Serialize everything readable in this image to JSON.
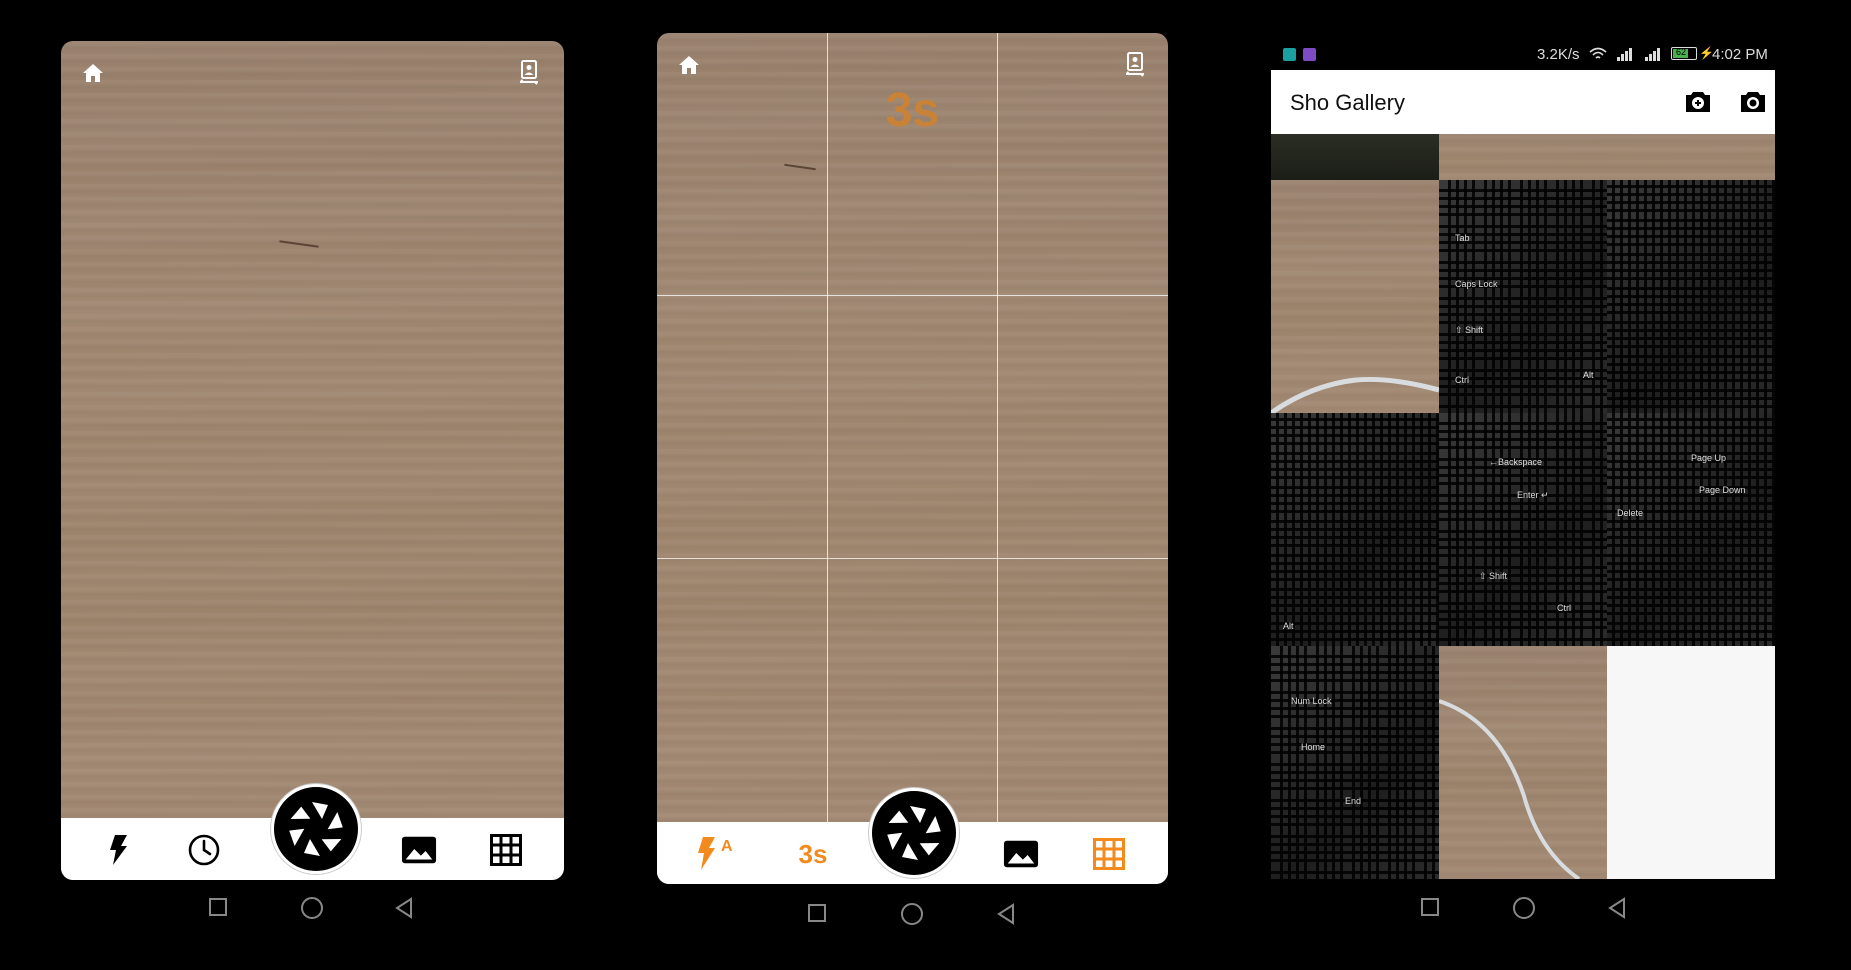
{
  "screen2": {
    "timer_overlay": "3s",
    "timer_button": "3s"
  },
  "screen3": {
    "status": {
      "speed": "3.2K/s",
      "battery": "62",
      "time": "4:02 PM"
    },
    "title": "Sho Gallery",
    "keys": {
      "tab": "Tab",
      "caps": "Caps Lock",
      "shift": "⇧ Shift",
      "ctrl": "Ctrl",
      "alt": "Alt",
      "backspace": "←Backspace",
      "enter": "Enter ↵",
      "delete": "Delete",
      "page_up": "Page Up",
      "page_down": "Page Down",
      "num_lock": "Num Lock",
      "end": "End",
      "home": "Home"
    }
  },
  "colors": {
    "accent": "#f28a1e",
    "timer_text": "#c98236"
  }
}
